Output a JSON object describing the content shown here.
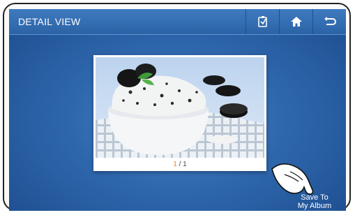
{
  "header": {
    "title": "DETAIL VIEW"
  },
  "toolbar": {
    "items": [
      {
        "icon": "album-edit-icon"
      },
      {
        "icon": "home-icon"
      },
      {
        "icon": "back-icon"
      }
    ]
  },
  "viewer": {
    "current_index": "1",
    "separator": " / ",
    "total": "1"
  },
  "actions": {
    "save_line1": "Save To",
    "save_line2": "My Album"
  },
  "colors": {
    "accent": "#e8822c",
    "bar": "#2c63a6",
    "background": "#2f67ad"
  }
}
